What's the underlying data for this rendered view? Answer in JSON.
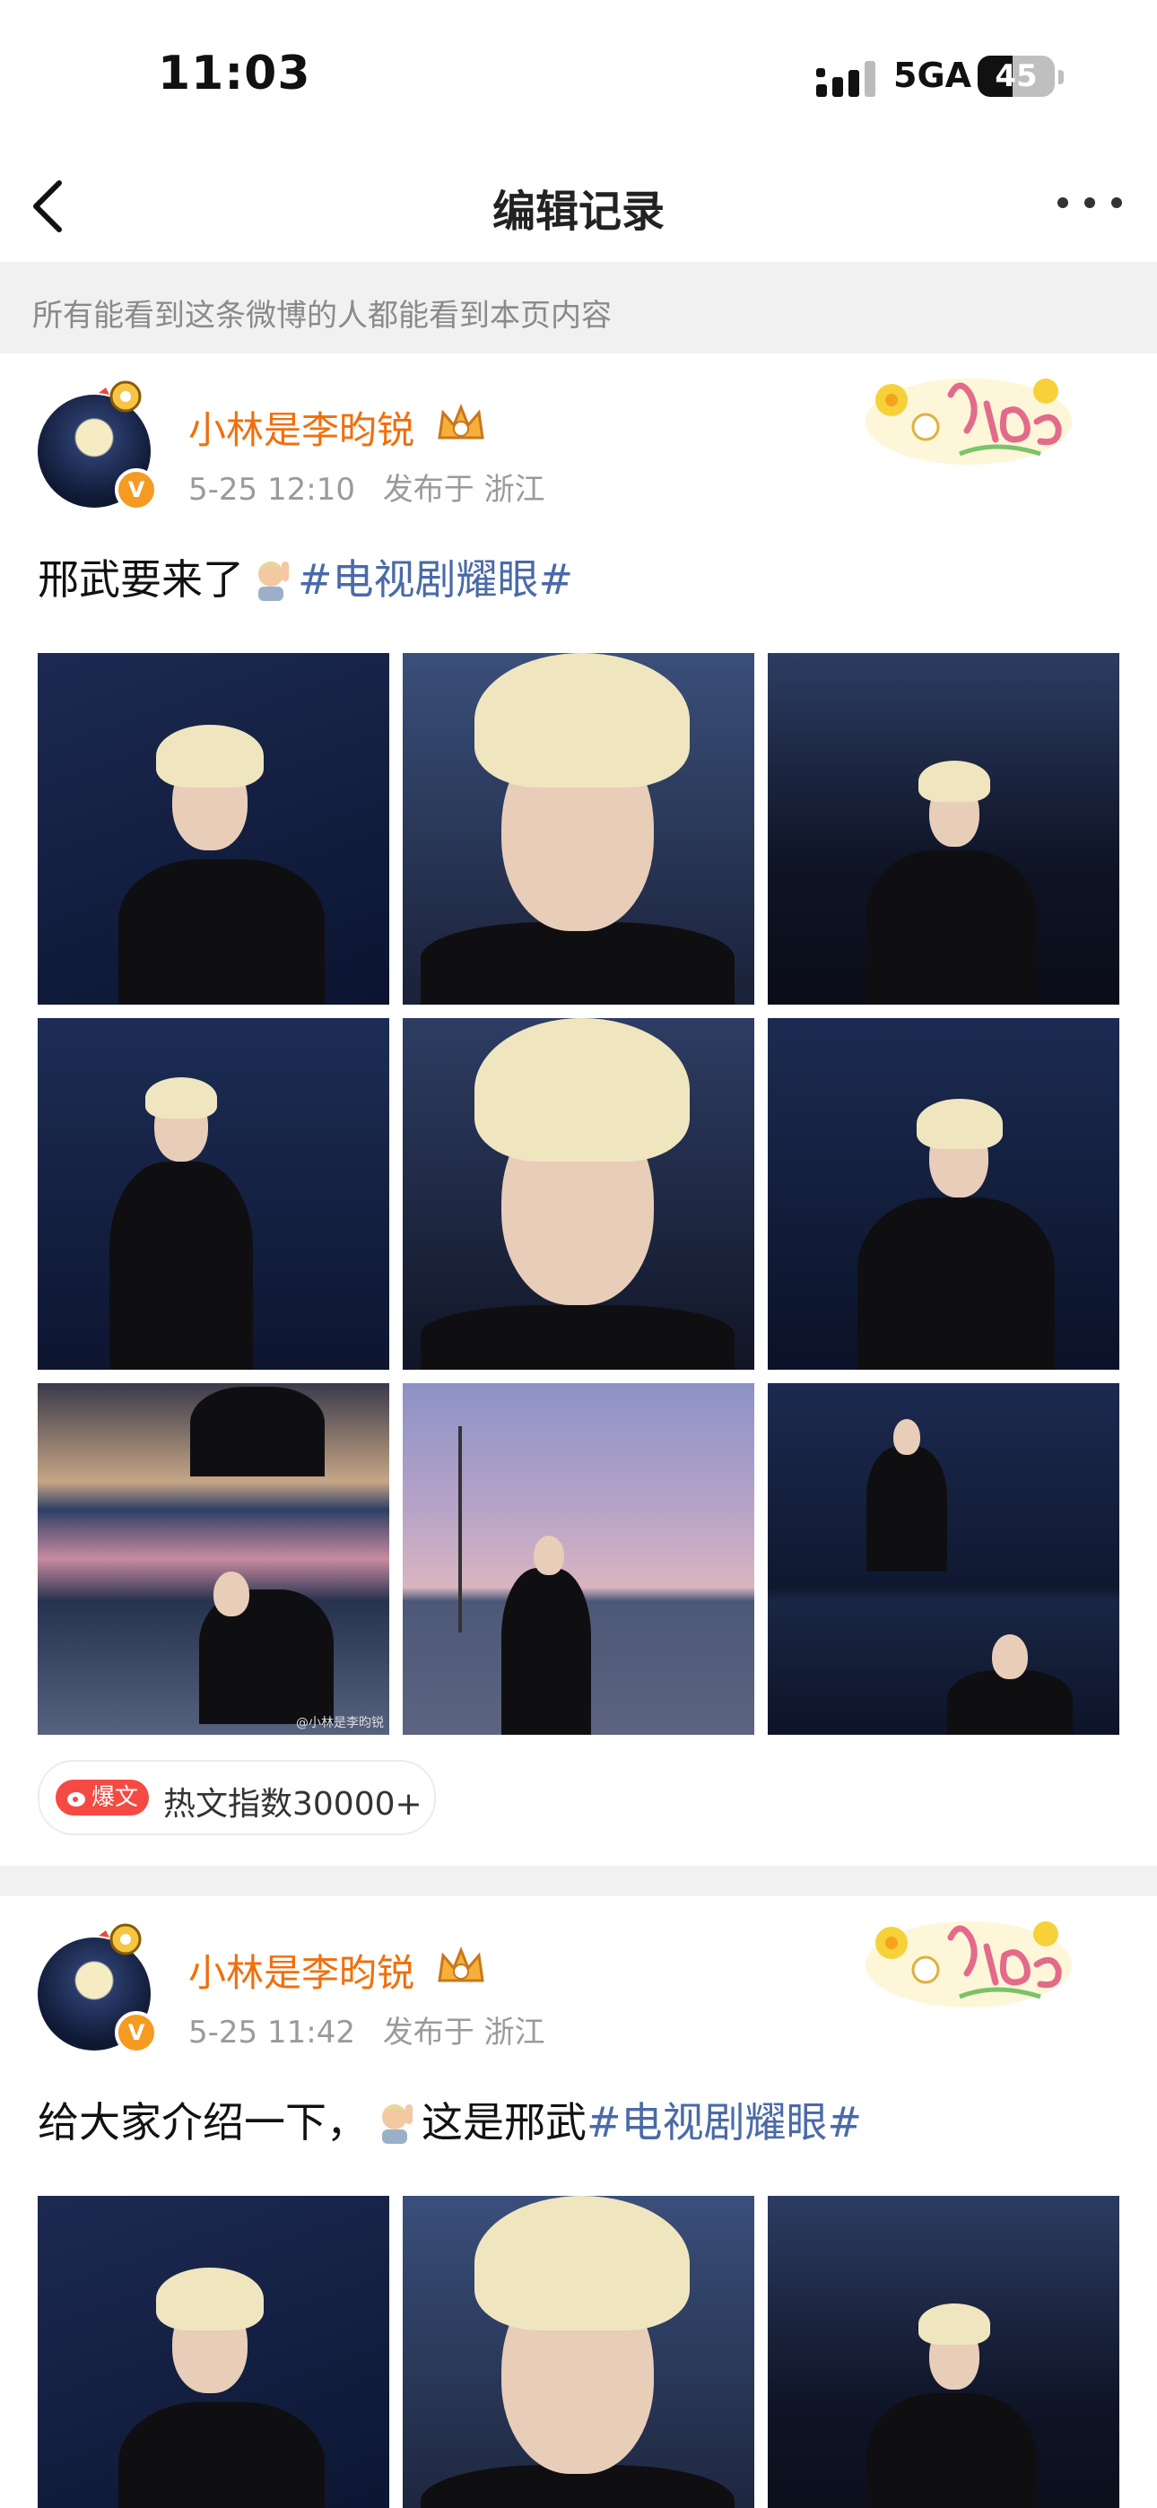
{
  "status_bar": {
    "time": "11:03",
    "network": "5GA",
    "battery": "45",
    "battery_level": 0.45
  },
  "nav": {
    "title": "编辑记录",
    "back_icon": "chevron-left-icon",
    "more_icon": "more-dots-icon"
  },
  "notice": "所有能看到这条微博的人都能看到本页内容",
  "posts": [
    {
      "username": "小林是李昀锐",
      "time": "5-25 12:10",
      "location": "发布于 浙江",
      "text": "邢武要来了",
      "emoji": "raising-hand-emoji",
      "hashtag": "#电视剧耀眼#",
      "sticker": "plog-sticker",
      "hot_tag": "爆文",
      "hot_text": "热文指数30000+",
      "watermark": "@小林是李昀锐"
    },
    {
      "username": "小林是李昀锐",
      "time": "5-25 11:42",
      "location": "发布于 浙江",
      "text": "给大家介绍一下，",
      "emoji": "raising-hand-emoji",
      "text_after": "这是邢武",
      "hashtag": "#电视剧耀眼#",
      "sticker": "plog-sticker"
    }
  ],
  "colors": {
    "username": "#f06f0c",
    "hashtag": "#4a6aa8",
    "hot_tag": "#f54a43",
    "meta": "#9a9a9a"
  }
}
